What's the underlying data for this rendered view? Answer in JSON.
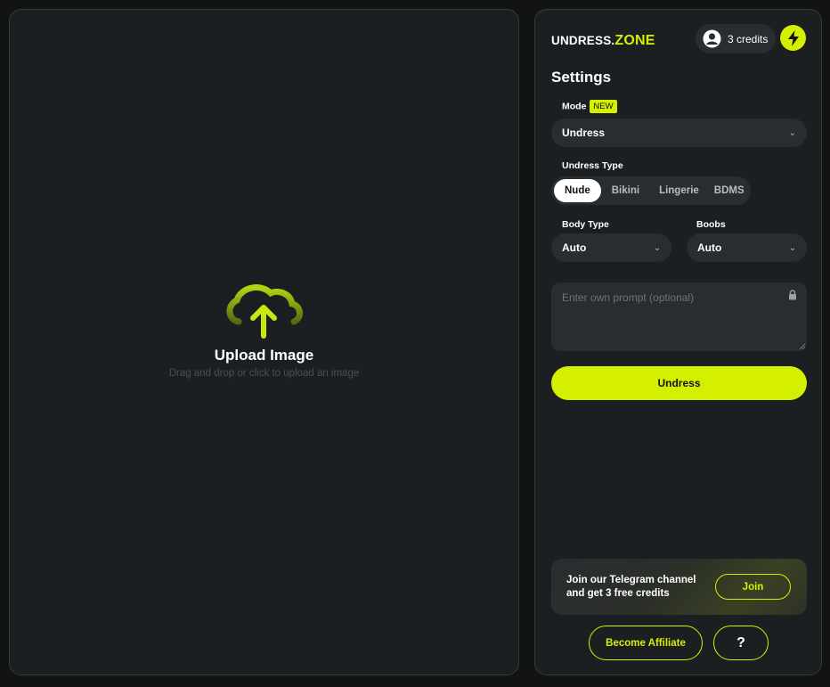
{
  "colors": {
    "accent": "#d4f000",
    "panel": "#1c1f21",
    "control": "#2a2d30",
    "background": "#111314"
  },
  "upload": {
    "title": "Upload Image",
    "subtitle": "Drag and drop or click to upload an image",
    "icon": "cloud-upload-icon"
  },
  "header": {
    "logo_part1": "UNDRESS.",
    "logo_part2": "ZONE",
    "credits": "3 credits",
    "user_icon": "user-avatar-icon",
    "boost_icon": "lightning-bolt-icon"
  },
  "settings": {
    "title": "Settings",
    "mode": {
      "label": "Mode",
      "badge": "NEW",
      "value": "Undress"
    },
    "undress_type": {
      "label": "Undress Type",
      "options": [
        "Nude",
        "Bikini",
        "Lingerie",
        "BDMS"
      ],
      "selected": "Nude"
    },
    "body_type": {
      "label": "Body Type",
      "value": "Auto"
    },
    "boobs": {
      "label": "Boobs",
      "value": "Auto"
    },
    "prompt": {
      "placeholder": "Enter own prompt (optional)",
      "value": ""
    },
    "submit_label": "Undress"
  },
  "telegram": {
    "line1": "Join our Telegram channel",
    "line2": "and get 3 free credits",
    "join_label": "Join"
  },
  "footer": {
    "affiliate_label": "Become Affiliate",
    "help_label": "?"
  }
}
